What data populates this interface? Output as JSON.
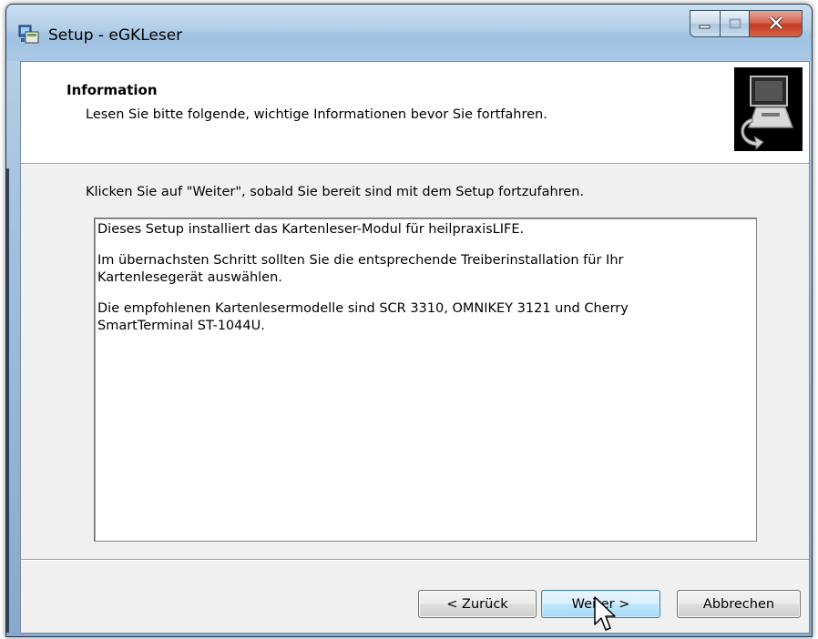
{
  "window": {
    "title": "Setup - eGKLeser"
  },
  "header": {
    "title": "Information",
    "subtitle": "Lesen Sie bitte folgende, wichtige Informationen bevor Sie fortfahren."
  },
  "instruction": "Klicken Sie auf \"Weiter\", sobald Sie bereit sind mit dem Setup fortzufahren.",
  "memo": {
    "paragraphs": [
      "Dieses Setup installiert das Kartenleser-Modul für heilpraxisLIFE.",
      "Im übernachsten Schritt sollten Sie die entsprechende Treiberinstallation für Ihr\nKartenlesegerät auswählen.",
      "Die empfohlenen Kartenlesermodelle sind SCR 3310, OMNIKEY 3121 und Cherry\nSmartTerminal ST-1044U."
    ]
  },
  "buttons": {
    "back": "< Zurück",
    "next": "Weiter >",
    "cancel": "Abbrechen"
  },
  "colors": {
    "titlebar": "#b1cde7",
    "close_button": "#c23b21",
    "next_button_border": "#3c7fb1"
  },
  "icons": {
    "title": "setup-icon",
    "minimize": "minimize-icon",
    "maximize": "maximize-icon",
    "close": "close-icon",
    "header": "computer-install-icon",
    "cursor": "mouse-pointer-icon"
  }
}
